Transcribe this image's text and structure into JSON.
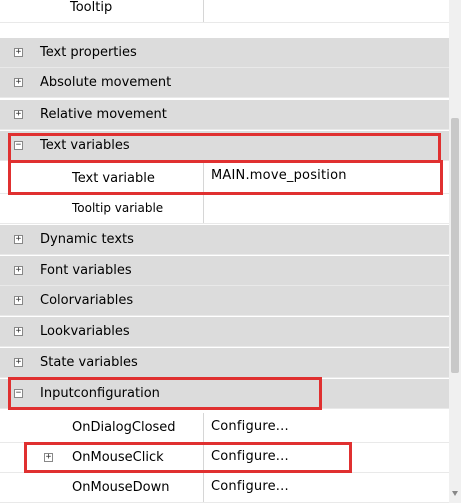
{
  "rows": [
    {
      "kind": "prop",
      "label": "Tooltip",
      "value": ""
    },
    {
      "kind": "group",
      "expander": "+",
      "label": "Text properties"
    },
    {
      "kind": "group",
      "expander": "+",
      "label": "Absolute movement"
    },
    {
      "kind": "group",
      "expander": "+",
      "label": "Relative movement"
    },
    {
      "kind": "group",
      "expander": "−",
      "label": "Text variables"
    },
    {
      "kind": "prop",
      "label": "Text variable",
      "value": "MAIN.move_position"
    },
    {
      "kind": "prop",
      "label": "Tooltip variable",
      "value": ""
    },
    {
      "kind": "group",
      "expander": "+",
      "label": "Dynamic texts"
    },
    {
      "kind": "group",
      "expander": "+",
      "label": "Font variables"
    },
    {
      "kind": "group",
      "expander": "+",
      "label": "Colorvariables"
    },
    {
      "kind": "group",
      "expander": "+",
      "label": "Lookvariables"
    },
    {
      "kind": "group",
      "expander": "+",
      "label": "State variables"
    },
    {
      "kind": "group",
      "expander": "−",
      "label": "Inputconfiguration"
    },
    {
      "kind": "prop",
      "label": "OnDialogClosed",
      "value": "Configure..."
    },
    {
      "kind": "prop",
      "expander": "+",
      "label": "OnMouseClick",
      "value": "Configure..."
    },
    {
      "kind": "prop",
      "label": "OnMouseDown",
      "value": "Configure..."
    }
  ],
  "colors": {
    "highlight": "#e03030",
    "group_bg": "#dcdcdc"
  }
}
